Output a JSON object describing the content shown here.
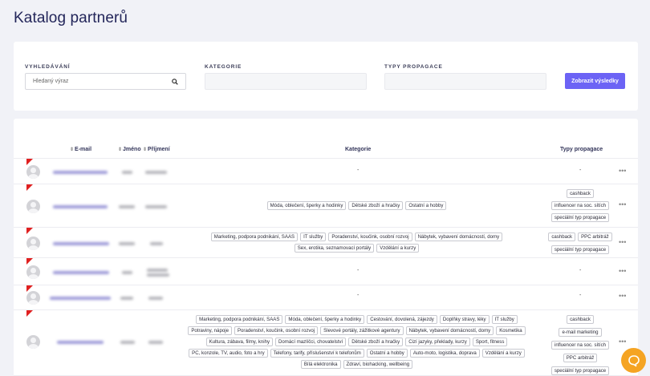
{
  "page": {
    "title": "Katalog partnerů"
  },
  "filters": {
    "search_label": "VYHLEDÁVÁNÍ",
    "search_placeholder": "Hledaný výraz",
    "category_label": "KATEGORIE",
    "promo_label": "TYPY PROPAGACE",
    "submit_label": "Zobrazit výsledky"
  },
  "table": {
    "headers": {
      "email": "E-mail",
      "first": "Jméno",
      "last": "Příjmení",
      "category": "Kategorie",
      "promo": "Typy propagace"
    },
    "rows": [
      {
        "category_dash": "-",
        "promo_dash": "-",
        "menu": "•••"
      },
      {
        "categories": [
          [
            "Móda, oblečení, šperky a hodinky",
            "Dětské zboží a hračky",
            "Ostatní a hobby"
          ]
        ],
        "promos": [
          "cashback",
          "influencer na soc. sítích",
          "speciální typ propagace"
        ],
        "menu": "•••"
      },
      {
        "categories": [
          [
            "Marketing, podpora podnikání, SAAS",
            "IT služby",
            "Poradenství, koučink, osobní rozvoj",
            "Nábytek, vybavení domácností, domy"
          ],
          [
            "Sex, erotika, seznamovací portály",
            "Vzdělání a kurzy"
          ]
        ],
        "promos": [
          [
            "cashback",
            "PPC arbitráž"
          ],
          "speciální typ propagace"
        ],
        "menu": "•••"
      },
      {
        "category_dash": "-",
        "promo_dash": "-",
        "menu": "•••"
      },
      {
        "category_dash": "-",
        "promo_dash": "-",
        "menu": "•••"
      },
      {
        "categories": [
          [
            "Marketing, podpora podnikání, SAAS",
            "Móda, oblečení, šperky a hodinky",
            "Cestování, dovolená, zájezdy",
            "Doplňky stravy, léky",
            "IT služby"
          ],
          [
            "Potraviny, nápoje",
            "Poradenství, koučink, osobní rozvoj",
            "Slevové portály, zážitkové agentury",
            "Nábytek, vybavení domácností, domy",
            "Kosmetika"
          ],
          [
            "Kultura, zábava, filmy, knihy",
            "Domácí mazlíčci, chovatelství",
            "Dětské zboží a hračky",
            "Cizí jazyky, překlady, kurzy",
            "Sport, fitness"
          ],
          [
            "PC, konzole, TV, audio, foto a hry",
            "Telefony, tarify, příslušenství k telefonům",
            "Ostatní a hobby",
            "Auto-moto, logistika, doprava",
            "Vzdělání a kurzy"
          ],
          [
            "Bílá elektronika",
            "Zdraví, biohacking, wellbeing"
          ]
        ],
        "promos": [
          "cashback",
          "e-mail marketing",
          "influencer na soc. sítích",
          "PPC arbitráž",
          "speciální typ propagace"
        ],
        "menu": "•••"
      }
    ]
  },
  "colors": {
    "accent": "#6c63f5",
    "flag": "#e02020",
    "chat": "#f5a423"
  },
  "icons": {
    "search": "search-icon",
    "chat": "chat-icon",
    "avatar": "avatar-icon"
  }
}
